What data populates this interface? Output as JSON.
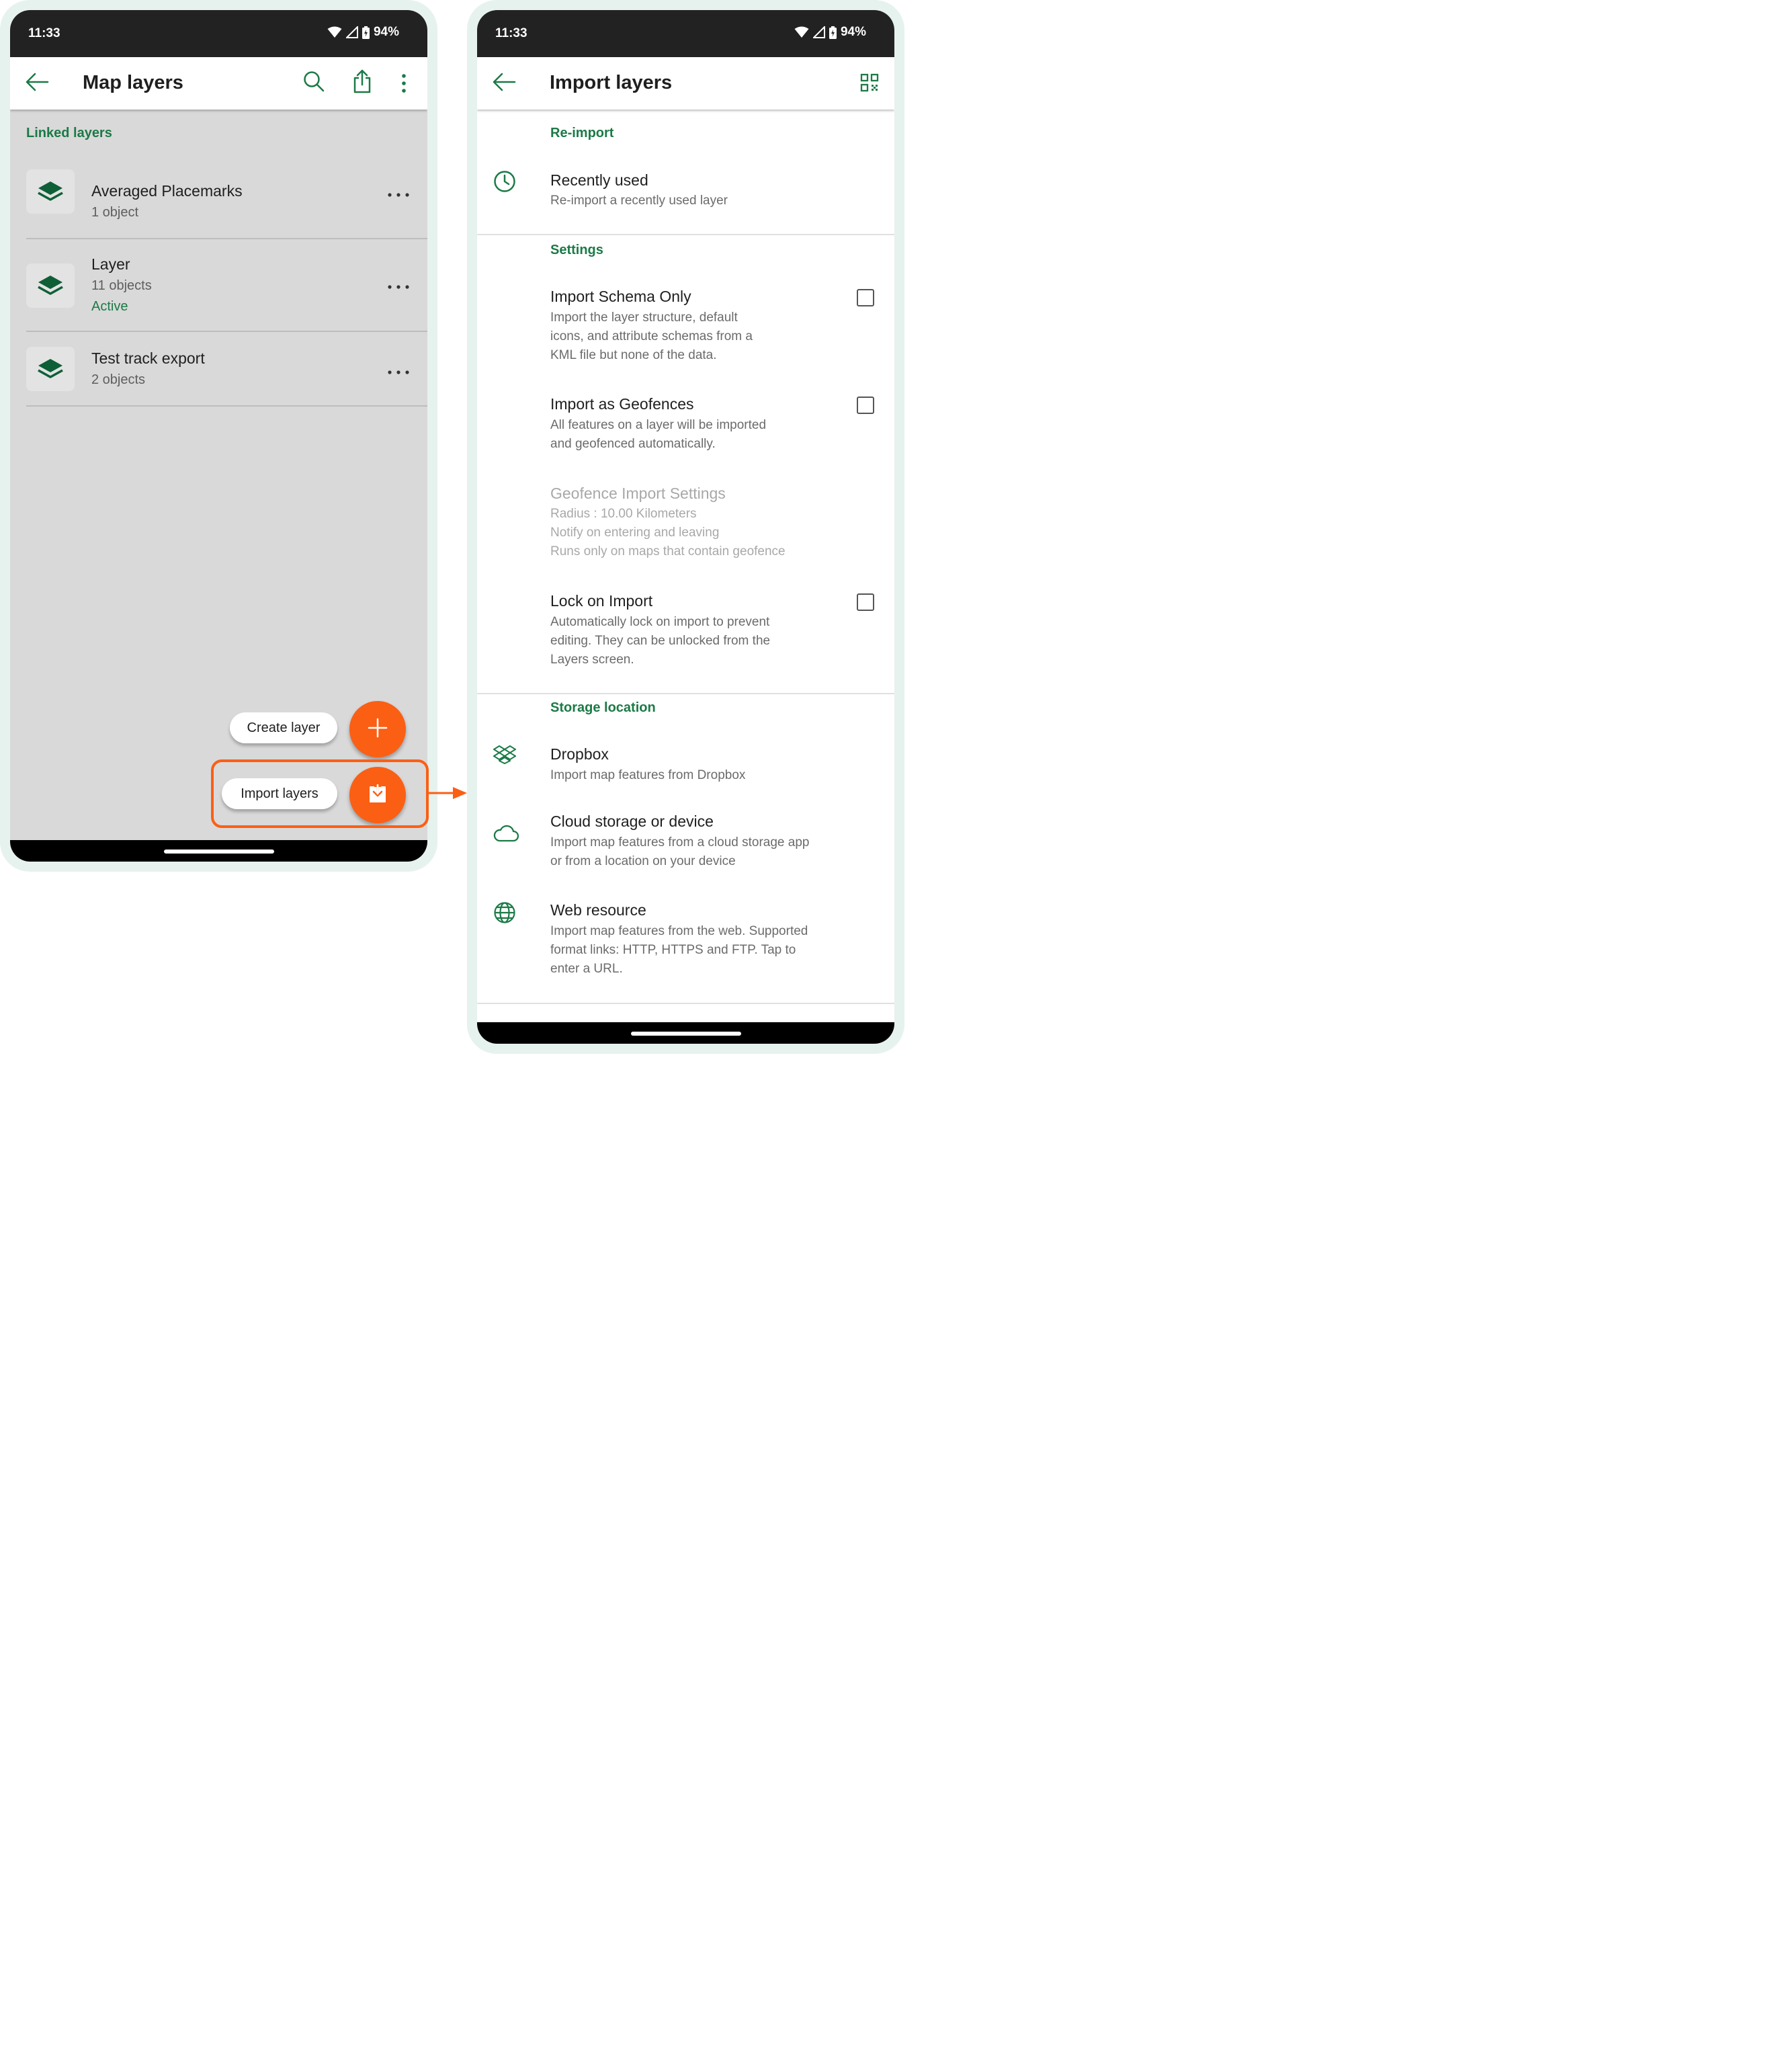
{
  "status": {
    "time": "11:33",
    "battery": "94%"
  },
  "left": {
    "title": "Map layers",
    "section": "Linked layers",
    "layers": [
      {
        "name": "Averaged Placemarks",
        "count": "1 object",
        "state": ""
      },
      {
        "name": "Layer",
        "count": "11 objects",
        "state": "Active"
      },
      {
        "name": "Test track export",
        "count": "2 objects",
        "state": ""
      }
    ],
    "fab_create_label": "Create layer",
    "fab_import_label": "Import layers"
  },
  "right": {
    "title": "Import layers",
    "reimport": {
      "header": "Re-import",
      "recent_title": "Recently used",
      "recent_sub": "Re-import a recently used layer"
    },
    "settings": {
      "header": "Settings",
      "schema_title": "Import Schema Only",
      "schema_sub_1": "Import the layer structure, default",
      "schema_sub_2": "icons, and attribute schemas from a",
      "schema_sub_3": "KML file but none of the data.",
      "geofence_title": "Import as Geofences",
      "geofence_sub_1": "All features on a layer will be imported",
      "geofence_sub_2": "and geofenced automatically.",
      "geoset_title": "Geofence Import Settings",
      "geoset_sub_1": "Radius : 10.00 Kilometers",
      "geoset_sub_2": "Notify on entering and leaving",
      "geoset_sub_3": "Runs only on maps that contain geofence",
      "lock_title": "Lock on Import",
      "lock_sub_1": "Automatically lock on import to prevent",
      "lock_sub_2": "editing. They can be unlocked from the",
      "lock_sub_3": "Layers screen."
    },
    "storage": {
      "header": "Storage location",
      "dropbox_title": "Dropbox",
      "dropbox_sub": "Import map features from Dropbox",
      "cloud_title": "Cloud storage or device",
      "cloud_sub_1": "Import map features from a cloud storage app",
      "cloud_sub_2": "or from a location on your device",
      "web_title": "Web resource",
      "web_sub_1": "Import map features from the web. Supported",
      "web_sub_2": "format links: HTTP, HTTPS and FTP. Tap to",
      "web_sub_3": "enter a URL."
    }
  },
  "colors": {
    "accent": "#1b7a46",
    "fab": "#fb5f14",
    "frame": "#e6f2ee"
  }
}
